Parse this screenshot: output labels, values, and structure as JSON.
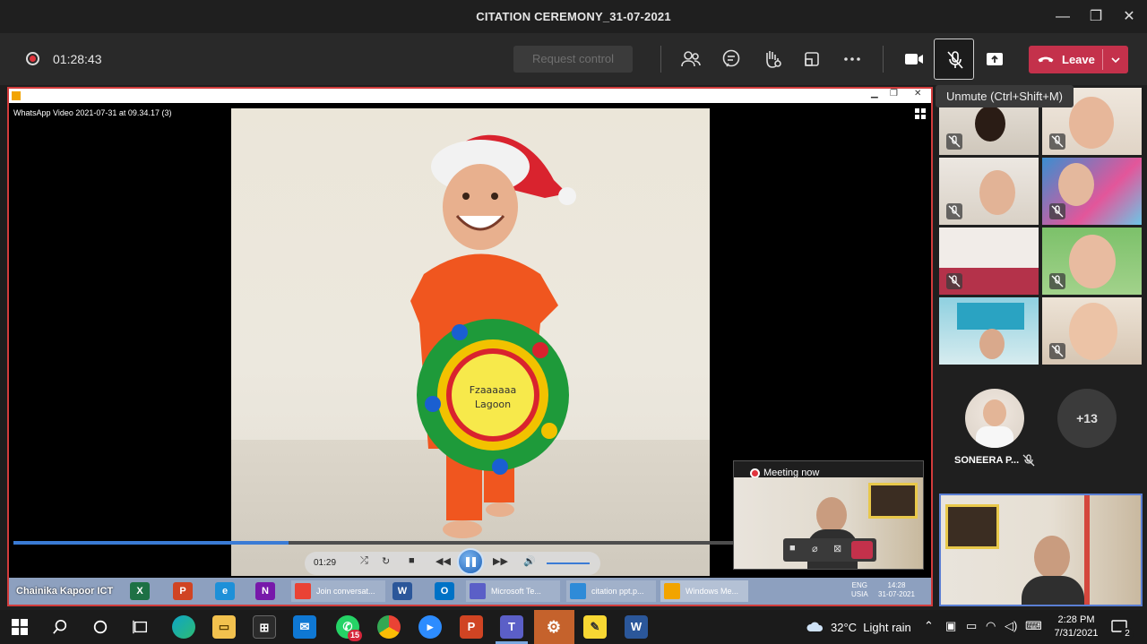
{
  "window": {
    "title": "CITATION CEREMONY_31-07-2021",
    "minimize": "—",
    "maximize": "❐",
    "close": "✕"
  },
  "meeting_toolbar": {
    "recording_time": "01:28:43",
    "request_control_label": "Request control",
    "leave_label": "Leave",
    "mic_tooltip": "Unmute (Ctrl+Shift+M)",
    "icons": [
      "participants-icon",
      "chat-icon",
      "raise-hand-icon",
      "room-icon",
      "more-icon",
      "camera-icon",
      "mic-off-icon",
      "share-icon"
    ],
    "accent_color": "#c4314b"
  },
  "shared_screen": {
    "player_window_title": "WhatsApp Video 2021-07-31 at 09.34.17 (3)",
    "current_time": "01:29",
    "progress_fraction": 0.37,
    "badge_text_line1": "Fzaaaaaa",
    "badge_text_line2": "Lagoon",
    "inner_taskbar": {
      "presenter_name": "Chainika Kapoor ICT",
      "windows": [
        {
          "label": "Join conversat...",
          "icon": "chrome-icon",
          "color": "#ea4335"
        },
        {
          "label": "Microsoft Te...",
          "icon": "teams-icon",
          "color": "#5b5fc7"
        },
        {
          "label": "citation ppt.p...",
          "icon": "video-editor-icon",
          "color": "#2e8bd8"
        },
        {
          "label": "Windows Me...",
          "icon": "media-player-icon",
          "color": "#f2a400"
        }
      ],
      "lang_line1": "ENG",
      "lang_line2": "USIA",
      "time": "14:28",
      "date": "31-07-2021"
    },
    "meeting_now_label": "Meeting now"
  },
  "participants": {
    "spotlight_name": "SONEERA P...",
    "overflow_count": "+13"
  },
  "taskbar": {
    "weather_temp": "32°C",
    "weather_desc": "Light rain",
    "time": "2:28 PM",
    "date": "7/31/2021",
    "whatsapp_badge": "15",
    "notification_count": "2"
  }
}
